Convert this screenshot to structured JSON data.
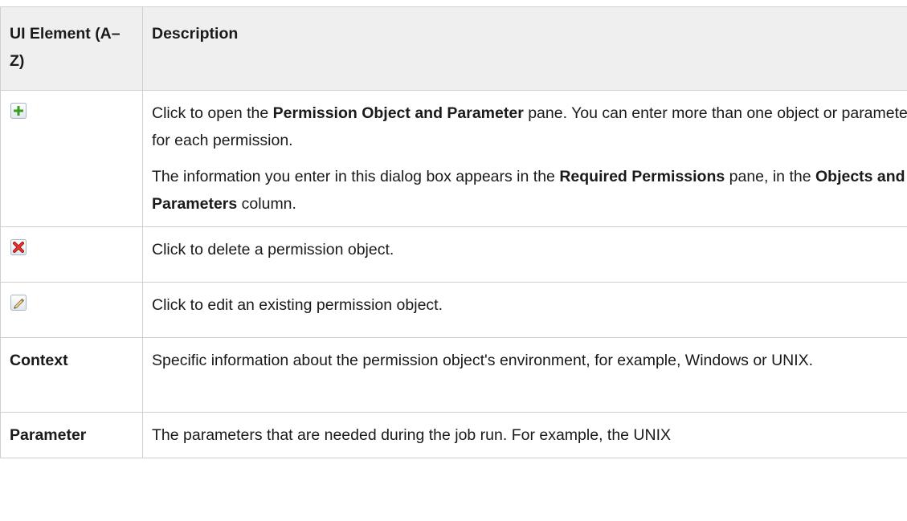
{
  "header": {
    "col1": "UI Element (A–Z)",
    "col2": "Description"
  },
  "rows": [
    {
      "icon": "add-icon",
      "desc": [
        [
          "Click to open the ",
          "Permission Object and Parameter",
          " pane. You can enter more than one object or parameter for each permission."
        ],
        [
          "The information you enter in this dialog box appears in the ",
          "Required Permissions",
          " pane, in the ",
          "Objects and Parameters",
          " column."
        ]
      ]
    },
    {
      "icon": "delete-icon",
      "desc": "Click to delete a permission object."
    },
    {
      "icon": "edit-icon",
      "desc": "Click to edit an existing permission object."
    },
    {
      "label": "Context",
      "desc": "Specific information about the permission object's environment, for example, Windows or UNIX."
    },
    {
      "label": "Parameter",
      "desc": "The parameters that are needed during the job run. For example, the UNIX"
    }
  ],
  "colors": {
    "header_bg": "#efefef",
    "border": "#cfcfcf",
    "add_green": "#3c9a1e",
    "delete_red": "#d9241b"
  }
}
